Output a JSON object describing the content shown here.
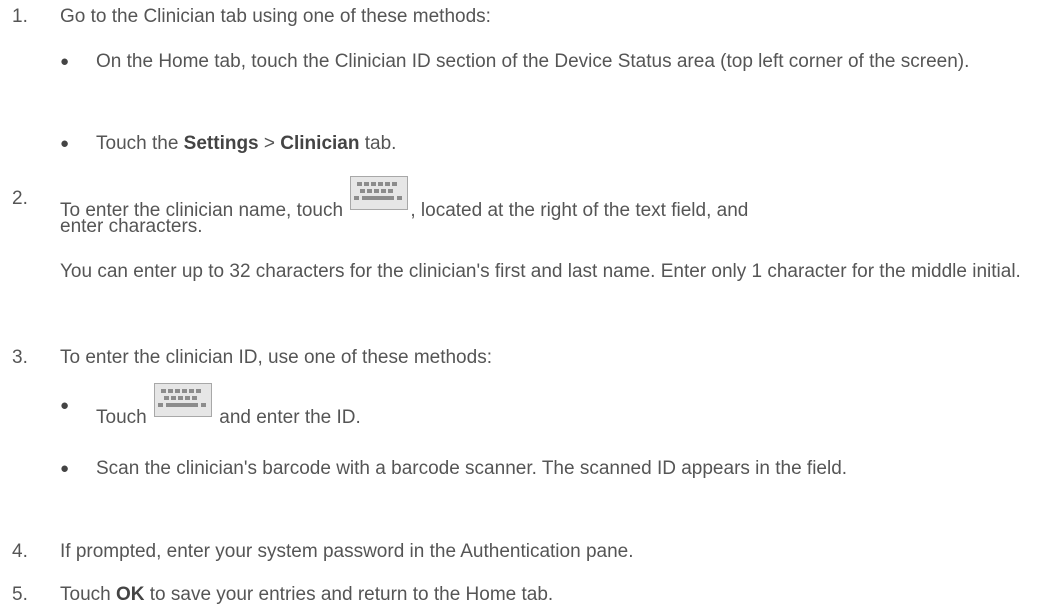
{
  "steps": [
    {
      "number": "1.",
      "text": "Go to the Clinician tab using one of these methods:",
      "bullets": [
        {
          "text": "On the Home tab, touch the Clinician ID section of the Device Status area (top left corner of the screen)."
        },
        {
          "before": "Touch the ",
          "bold1": "Settings",
          "sep": " > ",
          "bold2": "Clinician",
          "after": " tab."
        }
      ]
    },
    {
      "number": "2.",
      "text_before_icon": "To enter the clinician name, touch ",
      "icon": "keyboard-icon",
      "text_after_icon": ", located at the right of the text field, and",
      "text_line2": "enter characters.",
      "note": "You can enter up to 32 characters for the clinician's first and last name. Enter only 1 character for the middle initial."
    },
    {
      "number": "3.",
      "text": "To enter the clinician ID, use one of these methods:",
      "bullets": [
        {
          "before": "Touch ",
          "icon": "keyboard-icon",
          "after": " and enter the ID."
        },
        {
          "text": "Scan the clinician's barcode with a barcode scanner. The scanned ID appears in the field."
        }
      ]
    },
    {
      "number": "4.",
      "text": "If prompted, enter your system password in the Authentication pane."
    },
    {
      "number": "5.",
      "before": "Touch ",
      "bold": "OK",
      "after": " to save your entries and return to the Home tab."
    }
  ],
  "colors": {
    "text": "#555555",
    "icon_fill": "#e6e6e6",
    "icon_keys": "#8c8c8c"
  }
}
